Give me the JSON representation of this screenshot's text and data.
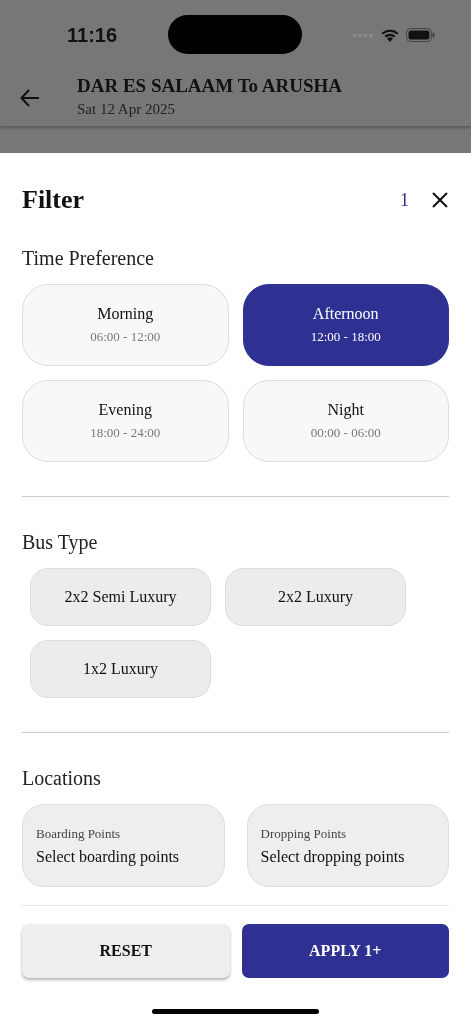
{
  "status_bar": {
    "time": "11:16"
  },
  "header": {
    "title": "DAR ES SALAAM To ARUSHA",
    "subtitle": "Sat 12 Apr 2025"
  },
  "filter": {
    "title": "Filter",
    "count": "1"
  },
  "time_preference": {
    "title": "Time Preference",
    "options": [
      {
        "label": "Morning",
        "range": "06:00 - 12:00",
        "selected": false
      },
      {
        "label": "Afternoon",
        "range": "12:00 - 18:00",
        "selected": true
      },
      {
        "label": "Evening",
        "range": "18:00 - 24:00",
        "selected": false
      },
      {
        "label": "Night",
        "range": "00:00 - 06:00",
        "selected": false
      }
    ]
  },
  "bus_type": {
    "title": "Bus Type",
    "options": [
      {
        "label": "2x2 Semi Luxury",
        "selected": false
      },
      {
        "label": "2x2 Luxury",
        "selected": false
      },
      {
        "label": "1x2 Luxury",
        "selected": false
      }
    ]
  },
  "locations": {
    "title": "Locations",
    "fields": [
      {
        "label": "Boarding Points",
        "placeholder": "Select boarding points"
      },
      {
        "label": "Dropping Points",
        "placeholder": "Select dropping points"
      }
    ]
  },
  "buttons": {
    "reset": "RESET",
    "apply": "APPLY 1+"
  }
}
